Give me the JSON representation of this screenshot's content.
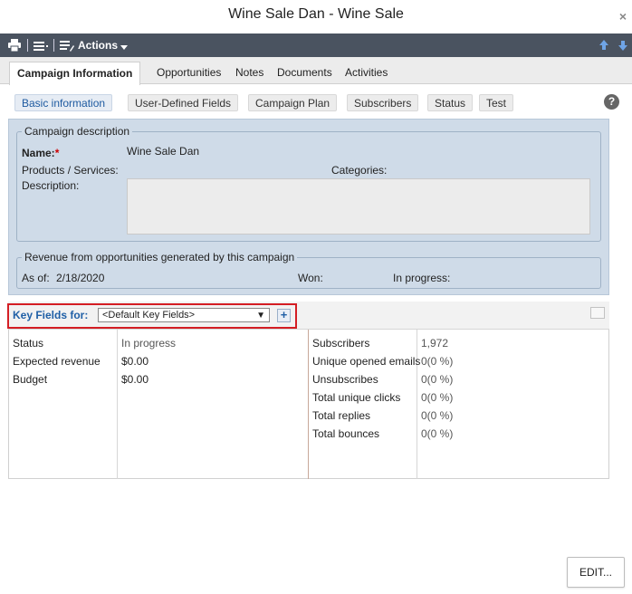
{
  "window": {
    "title": "Wine Sale Dan - Wine Sale",
    "close_glyph": "×"
  },
  "toolbar": {
    "actions_label": "Actions",
    "icons": [
      "print-icon",
      "list-icon",
      "edit-list-icon",
      "arrow-up-icon",
      "arrow-down-icon"
    ]
  },
  "tabs": [
    {
      "label": "Campaign Information",
      "active": true
    },
    {
      "label": "Opportunities"
    },
    {
      "label": "Notes"
    },
    {
      "label": "Documents"
    },
    {
      "label": "Activities"
    }
  ],
  "subtabs": [
    {
      "label": "Basic information",
      "active": true
    },
    {
      "label": "User-Defined Fields"
    },
    {
      "label": "Campaign Plan"
    },
    {
      "label": "Subscribers"
    },
    {
      "label": "Status"
    },
    {
      "label": "Test"
    }
  ],
  "help_glyph": "?",
  "campaign_description": {
    "legend": "Campaign description",
    "name_label": "Name:",
    "required_mark": "*",
    "name_value": "Wine Sale Dan",
    "products_label": "Products / Services:",
    "categories_label": "Categories:",
    "description_label": "Description:"
  },
  "revenue": {
    "legend": "Revenue from opportunities generated by this campaign",
    "as_of_label": "As of:",
    "as_of_value": "2/18/2020",
    "won_label": "Won:",
    "in_progress_label": "In progress:"
  },
  "key_fields": {
    "label": "Key Fields for:",
    "selected": "<Default Key Fields>",
    "caret": "▼",
    "plus": "+"
  },
  "left_fields": [
    {
      "label": "Status",
      "value": "In progress"
    },
    {
      "label": "Expected revenue",
      "value": "$0.00"
    },
    {
      "label": "Budget",
      "value": "$0.00"
    }
  ],
  "right_fields": [
    {
      "label": "Subscribers",
      "value": "1,972"
    },
    {
      "label": "Unique opened emails",
      "value": "0(0 %)"
    },
    {
      "label": "Unsubscribes",
      "value": "0(0 %)"
    },
    {
      "label": "Total unique clicks",
      "value": "0(0 %)"
    },
    {
      "label": "Total replies",
      "value": "0(0 %)"
    },
    {
      "label": "Total bounces",
      "value": "0(0 %)"
    }
  ],
  "footer": {
    "edit_label": "EDIT..."
  },
  "colors": {
    "toolbar": "#4a5360",
    "panel": "#cfdbe8",
    "accent": "#1f5fa6",
    "highlight": "#d41e24"
  }
}
